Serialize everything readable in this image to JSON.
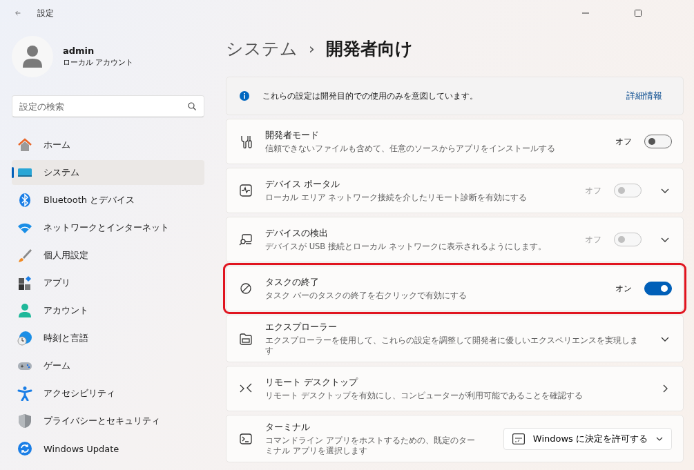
{
  "window": {
    "title": "設定"
  },
  "user": {
    "name": "admin",
    "account_type": "ローカル アカウント"
  },
  "search": {
    "placeholder": "設定の検索"
  },
  "sidebar": {
    "items": [
      {
        "label": "ホーム",
        "selected": false
      },
      {
        "label": "システム",
        "selected": true
      },
      {
        "label": "Bluetooth とデバイス",
        "selected": false
      },
      {
        "label": "ネットワークとインターネット",
        "selected": false
      },
      {
        "label": "個人用設定",
        "selected": false
      },
      {
        "label": "アプリ",
        "selected": false
      },
      {
        "label": "アカウント",
        "selected": false
      },
      {
        "label": "時刻と言語",
        "selected": false
      },
      {
        "label": "ゲーム",
        "selected": false
      },
      {
        "label": "アクセシビリティ",
        "selected": false
      },
      {
        "label": "プライバシーとセキュリティ",
        "selected": false
      },
      {
        "label": "Windows Update",
        "selected": false
      }
    ]
  },
  "breadcrumb": {
    "parent": "システム",
    "separator": "›",
    "current": "開発者向け"
  },
  "info_banner": {
    "text": "これらの設定は開発目的での使用のみを意図しています。",
    "link": "詳細情報"
  },
  "settings": [
    {
      "kind": "toggle",
      "title": "開発者モード",
      "description": "信頼できないファイルも含めて、任意のソースからアプリをインストールする",
      "state_label": "オフ",
      "on": false,
      "disabled": false,
      "highlighted": false
    },
    {
      "kind": "toggle_expand",
      "title": "デバイス ポータル",
      "description": "ローカル エリア ネットワーク接続を介したリモート診断を有効にする",
      "state_label": "オフ",
      "on": false,
      "disabled": true,
      "highlighted": false
    },
    {
      "kind": "toggle_expand",
      "title": "デバイスの検出",
      "description": "デバイスが USB 接続とローカル ネットワークに表示されるようにします。",
      "state_label": "オフ",
      "on": false,
      "disabled": true,
      "highlighted": false
    },
    {
      "kind": "toggle",
      "title": "タスクの終了",
      "description": "タスク バーのタスクの終了を右クリックで有効にする",
      "state_label": "オン",
      "on": true,
      "disabled": false,
      "highlighted": true
    },
    {
      "kind": "expand",
      "title": "エクスプローラー",
      "description": "エクスプローラーを使用して、これらの設定を調整して開発者に優しいエクスペリエンスを実現します",
      "highlighted": false
    },
    {
      "kind": "link",
      "title": "リモート デスクトップ",
      "description": "リモート デスクトップを有効にし、コンピューターが利用可能であることを確認する",
      "highlighted": false
    },
    {
      "kind": "dropdown",
      "title": "ターミナル",
      "description": "コマンドライン アプリをホストするための、既定のターミナル アプリを選択します",
      "value": "Windows に決定を許可する",
      "highlighted": false
    }
  ]
}
